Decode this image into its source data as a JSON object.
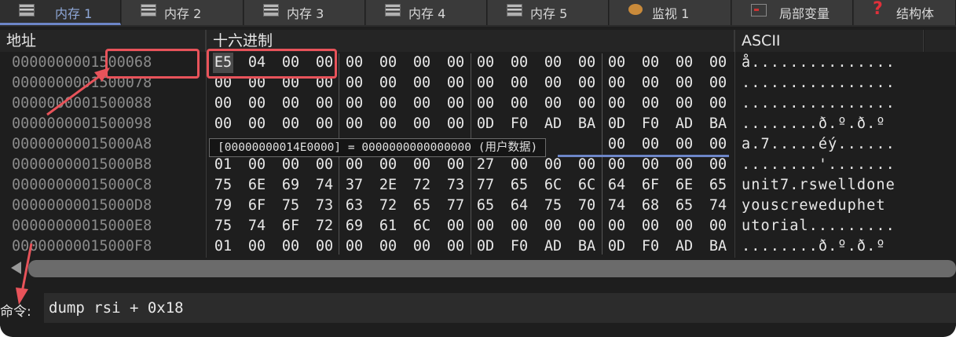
{
  "tabs": [
    {
      "label": "内存 1",
      "icon": "memory-icon",
      "active": true
    },
    {
      "label": "内存 2",
      "icon": "memory-icon"
    },
    {
      "label": "内存 3",
      "icon": "memory-icon"
    },
    {
      "label": "内存 4",
      "icon": "memory-icon"
    },
    {
      "label": "内存 5",
      "icon": "memory-icon"
    },
    {
      "label": "监视 1",
      "icon": "watch-icon"
    },
    {
      "label": "局部变量",
      "icon": "locals-icon"
    },
    {
      "label": "结构体",
      "icon": "struct-icon"
    }
  ],
  "headers": {
    "address": "地址",
    "hex": "十六进制",
    "ascii": "ASCII"
  },
  "rows": [
    {
      "addr": "0000000001500068",
      "bytes": [
        "E5",
        "04",
        "00",
        "00",
        "00",
        "00",
        "00",
        "00",
        "00",
        "00",
        "00",
        "00",
        "00",
        "00",
        "00",
        "00"
      ],
      "ascii": "å..............."
    },
    {
      "addr": "0000000001500078",
      "bytes": [
        "00",
        "00",
        "00",
        "00",
        "00",
        "00",
        "00",
        "00",
        "00",
        "00",
        "00",
        "00",
        "00",
        "00",
        "00",
        "00"
      ],
      "ascii": "................"
    },
    {
      "addr": "0000000001500088",
      "bytes": [
        "00",
        "00",
        "00",
        "00",
        "00",
        "00",
        "00",
        "00",
        "00",
        "00",
        "00",
        "00",
        "00",
        "00",
        "00",
        "00"
      ],
      "ascii": "................"
    },
    {
      "addr": "0000000001500098",
      "bytes": [
        "00",
        "00",
        "00",
        "00",
        "00",
        "00",
        "00",
        "00",
        "0D",
        "F0",
        "AD",
        "BA",
        "0D",
        "F0",
        "AD",
        "BA"
      ],
      "ascii": "........ð.º.ð.º"
    },
    {
      "addr": "00000000015000A8",
      "bytes": [
        "",
        "",
        "",
        "",
        "",
        "",
        "",
        "",
        "",
        "",
        "",
        "",
        "00",
        "00",
        "00",
        "00"
      ],
      "ascii": "a.7.....éý......"
    },
    {
      "addr": "00000000015000B8",
      "bytes": [
        "01",
        "00",
        "00",
        "00",
        "00",
        "00",
        "00",
        "00",
        "27",
        "00",
        "00",
        "00",
        "00",
        "00",
        "00",
        "00"
      ],
      "ascii": "........'......."
    },
    {
      "addr": "00000000015000C8",
      "bytes": [
        "75",
        "6E",
        "69",
        "74",
        "37",
        "2E",
        "72",
        "73",
        "77",
        "65",
        "6C",
        "6C",
        "64",
        "6F",
        "6E",
        "65"
      ],
      "ascii": "unit7.rswelldone"
    },
    {
      "addr": "00000000015000D8",
      "bytes": [
        "79",
        "6F",
        "75",
        "73",
        "63",
        "72",
        "65",
        "77",
        "65",
        "64",
        "75",
        "70",
        "74",
        "68",
        "65",
        "74"
      ],
      "ascii": "youscreweduphet"
    },
    {
      "addr": "00000000015000E8",
      "bytes": [
        "75",
        "74",
        "6F",
        "72",
        "69",
        "61",
        "6C",
        "00",
        "00",
        "00",
        "00",
        "00",
        "00",
        "00",
        "00",
        "00"
      ],
      "ascii": "utorial........."
    },
    {
      "addr": "00000000015000F8",
      "bytes": [
        "01",
        "00",
        "00",
        "00",
        "00",
        "00",
        "00",
        "00",
        "0D",
        "F0",
        "AD",
        "BA",
        "0D",
        "F0",
        "AD",
        "BA"
      ],
      "ascii": "........ð.º.ð.º"
    }
  ],
  "tooltip": "[00000000014E0000] = 0000000000000000 (用户数据)",
  "command": {
    "label": "命令:",
    "value": "dump rsi + 0x18"
  },
  "colors": {
    "annotation": "#e8535a",
    "accent": "#6d86c8"
  }
}
